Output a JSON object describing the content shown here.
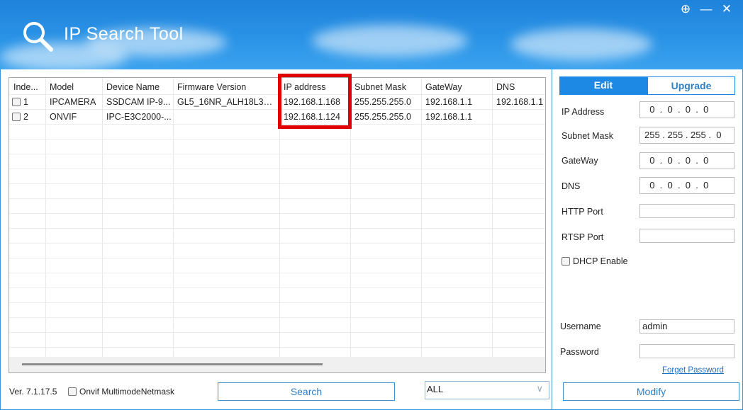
{
  "app": {
    "title": "IP Search Tool",
    "window_buttons": [
      "⊕",
      "—",
      "✕"
    ]
  },
  "table": {
    "columns": [
      "Inde...",
      "Model",
      "Device Name",
      "Firmware Version",
      "IP address",
      "Subnet Mask",
      "GateWay",
      "DNS"
    ],
    "rows": [
      {
        "index": "1",
        "model": "IPCAMERA",
        "device_name": "SSDCAM IP-9...",
        "firmware": "GL5_16NR_ALH18L3A0...",
        "ip": "192.168.1.168",
        "mask": "255.255.255.0",
        "gateway": "192.168.1.1",
        "dns": "192.168.1.1"
      },
      {
        "index": "2",
        "model": "ONVIF",
        "device_name": "IPC-E3C2000-...",
        "firmware": "",
        "ip": "192.168.1.124",
        "mask": "255.255.255.0",
        "gateway": "192.168.1.1",
        "dns": ""
      }
    ]
  },
  "panel": {
    "tabs": {
      "edit": "Edit",
      "upgrade": "Upgrade"
    },
    "ip_label": "IP Address",
    "ip_value": "  0  .  0  .  0  .  0",
    "mask_label": "Subnet Mask",
    "mask_value": "255 . 255 . 255 .  0",
    "gateway_label": "GateWay",
    "gateway_value": "  0  .  0  .  0  .  0",
    "dns_label": "DNS",
    "dns_value": "  0  .  0  .  0  .  0",
    "http_label": "HTTP Port",
    "http_value": "",
    "rtsp_label": "RTSP Port",
    "rtsp_value": "",
    "dhcp_label": "DHCP Enable",
    "username_label": "Username",
    "username_value": "admin",
    "password_label": "Password",
    "password_value": "",
    "forget": "Forget Password",
    "modify": "Modify"
  },
  "footer": {
    "version": "Ver. 7.1.17.5",
    "onvif_label": "Onvif MultimodeNetmask",
    "search": "Search",
    "filter": "ALL"
  },
  "colors": {
    "accent": "#1e88e5",
    "highlight": "#e00000"
  }
}
